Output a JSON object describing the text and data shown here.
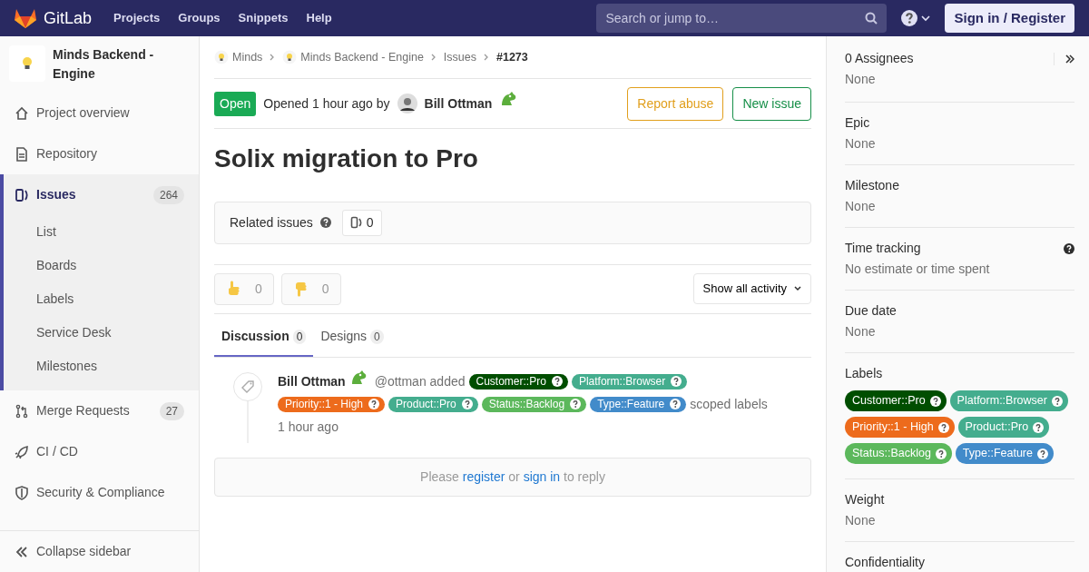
{
  "navbar": {
    "brand": "GitLab",
    "links": [
      "Projects",
      "Groups",
      "Snippets",
      "Help"
    ],
    "search": {
      "placeholder": "Search or jump to…"
    },
    "sign_in": "Sign in / Register"
  },
  "sidebar": {
    "project_name": "Minds Backend - Engine",
    "items": [
      {
        "label": "Project overview",
        "selected": false
      },
      {
        "label": "Repository",
        "selected": false
      },
      {
        "label": "Issues",
        "count": "264",
        "selected": true,
        "children": [
          {
            "label": "List"
          },
          {
            "label": "Boards"
          },
          {
            "label": "Labels"
          },
          {
            "label": "Service Desk"
          },
          {
            "label": "Milestones"
          }
        ]
      },
      {
        "label": "Merge Requests",
        "count": "27",
        "selected": false
      },
      {
        "label": "CI / CD",
        "selected": false
      },
      {
        "label": "Security & Compliance",
        "selected": false
      }
    ],
    "collapse": "Collapse sidebar"
  },
  "breadcrumbs": [
    {
      "label": "Minds",
      "kind": "group"
    },
    {
      "label": "Minds Backend - Engine",
      "kind": "project"
    },
    {
      "label": "Issues",
      "kind": "link"
    },
    {
      "label": "#1273",
      "kind": "current"
    }
  ],
  "issue": {
    "status": "Open",
    "opened": "Opened 1 hour ago by",
    "author": "Bill Ottman",
    "buttons": [
      {
        "label": "Report abuse",
        "kind": "warning"
      },
      {
        "label": "New issue",
        "kind": "success"
      }
    ],
    "title": "Solix migration to Pro"
  },
  "related": {
    "label": "Related issues",
    "count": "0"
  },
  "awards": [
    {
      "kind": "thumbsup",
      "count": "0"
    },
    {
      "kind": "thumbsdown",
      "count": "0"
    }
  ],
  "activity_filter": "Show all activity",
  "tabs": [
    {
      "label": "Discussion",
      "count": "0",
      "selected": true
    },
    {
      "label": "Designs",
      "count": "0",
      "selected": false
    }
  ],
  "note": {
    "author": "Bill Ottman",
    "action": "@ottman added",
    "labels": [
      {
        "label": "Customer::Pro",
        "color": "#004e00"
      },
      {
        "label": "Platform::Browser",
        "color": "#44ad8e"
      },
      {
        "label": "Priority::1 - High",
        "color": "#ed6b1c"
      },
      {
        "label": "Product::Pro",
        "color": "#44ad8e"
      },
      {
        "label": "Status::Backlog",
        "color": "#5cb85c"
      },
      {
        "label": "Type::Feature",
        "color": "#428bca"
      }
    ],
    "labels_suffix": "scoped labels",
    "time": "1 hour ago"
  },
  "reply": [
    {
      "text": "Please",
      "kind": "text"
    },
    {
      "text": "register",
      "kind": "link"
    },
    {
      "text": "or",
      "kind": "text"
    },
    {
      "text": "sign in",
      "kind": "link"
    },
    {
      "text": "to reply",
      "kind": "text"
    }
  ],
  "labels": [
    {
      "label": "Customer::Pro",
      "color": "#004e00"
    },
    {
      "label": "Platform::Browser",
      "color": "#44ad8e"
    },
    {
      "label": "Priority::1 - High",
      "color": "#ed6b1c"
    },
    {
      "label": "Product::Pro",
      "color": "#44ad8e"
    },
    {
      "label": "Status::Backlog",
      "color": "#5cb85c"
    },
    {
      "label": "Type::Feature",
      "color": "#428bca"
    }
  ],
  "right_sidebar": [
    {
      "kind": "assignees",
      "title": "0 Assignees",
      "value": "None"
    },
    {
      "kind": "plain",
      "title": "Epic",
      "value": "None"
    },
    {
      "kind": "plain",
      "title": "Milestone",
      "value": "None"
    },
    {
      "kind": "help",
      "title": "Time tracking",
      "value": "No estimate or time spent"
    },
    {
      "kind": "plain",
      "title": "Due date",
      "value": "None"
    },
    {
      "kind": "labels",
      "title": "Labels"
    },
    {
      "kind": "plain",
      "title": "Weight",
      "value": "None"
    },
    {
      "kind": "plain",
      "title": "Confidentiality"
    }
  ]
}
